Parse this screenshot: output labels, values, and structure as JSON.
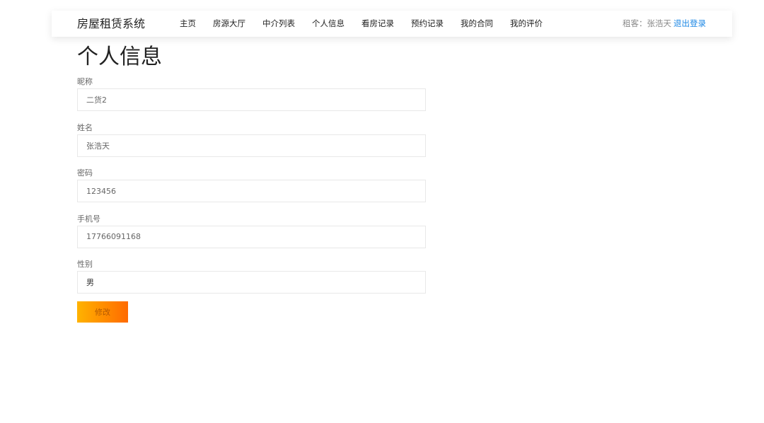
{
  "header": {
    "brand": "房屋租赁系统",
    "nav": [
      {
        "label": "主页"
      },
      {
        "label": "房源大厅"
      },
      {
        "label": "中介列表"
      },
      {
        "label": "个人信息"
      },
      {
        "label": "看房记录"
      },
      {
        "label": "预约记录"
      },
      {
        "label": "我的合同"
      },
      {
        "label": "我的评价"
      }
    ],
    "user_label": "租客：张浩天",
    "logout_label": "退出登录",
    "logout_color": "#1e88e5"
  },
  "page": {
    "title": "个人信息"
  },
  "form": {
    "fields": [
      {
        "label": "昵称",
        "value": "二货2"
      },
      {
        "label": "姓名",
        "value": "张浩天"
      },
      {
        "label": "密码",
        "value": "123456"
      },
      {
        "label": "手机号",
        "value": "17766091168"
      },
      {
        "label": "性别",
        "value": "男"
      }
    ],
    "submit_label": "修改",
    "submit_gradient": [
      "#ffb300",
      "#ff6a00"
    ]
  }
}
